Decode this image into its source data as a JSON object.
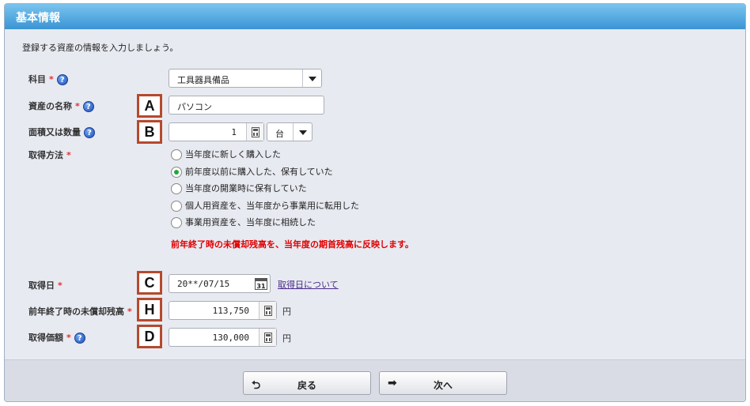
{
  "header": {
    "title": "基本情報"
  },
  "intro": "登録する資産の情報を入力しましょう。",
  "required_mark": "*",
  "help_glyph": "?",
  "form": {
    "account": {
      "label": "科目",
      "value": "工具器具備品"
    },
    "asset_name": {
      "label": "資産の名称",
      "marker": "A",
      "value": "パソコン"
    },
    "quantity": {
      "label": "面積又は数量",
      "marker": "B",
      "value": "1",
      "unit": "台"
    },
    "acquisition_method": {
      "label": "取得方法",
      "options": [
        {
          "label": "当年度に新しく購入した",
          "checked": false
        },
        {
          "label": "前年度以前に購入した、保有していた",
          "checked": true
        },
        {
          "label": "当年度の開業時に保有していた",
          "checked": false
        },
        {
          "label": "個人用資産を、当年度から事業用に転用した",
          "checked": false
        },
        {
          "label": "事業用資産を、当年度に相続した",
          "checked": false
        }
      ],
      "notice": "前年終了時の未償却残高を、当年度の期首残高に反映します。"
    },
    "acquisition_date": {
      "label": "取得日",
      "marker": "C",
      "value": "20**/07/15",
      "calendar_day": "31",
      "link": "取得日について"
    },
    "prior_book_value": {
      "label": "前年終了時の未償却残高",
      "marker": "H",
      "value": "113,750",
      "unit": "円"
    },
    "acquisition_price": {
      "label": "取得価額",
      "marker": "D",
      "value": "130,000",
      "unit": "円"
    }
  },
  "footer": {
    "back": {
      "label": "戻る",
      "icon": "back-arrow-icon"
    },
    "next": {
      "label": "次へ",
      "icon": "forward-arrow-icon"
    }
  },
  "colors": {
    "header": "#3a95d4",
    "required": "#e53030",
    "notice": "#e00000",
    "marker_border": "#b54a2c",
    "radio_checked": "#1fa83a"
  }
}
